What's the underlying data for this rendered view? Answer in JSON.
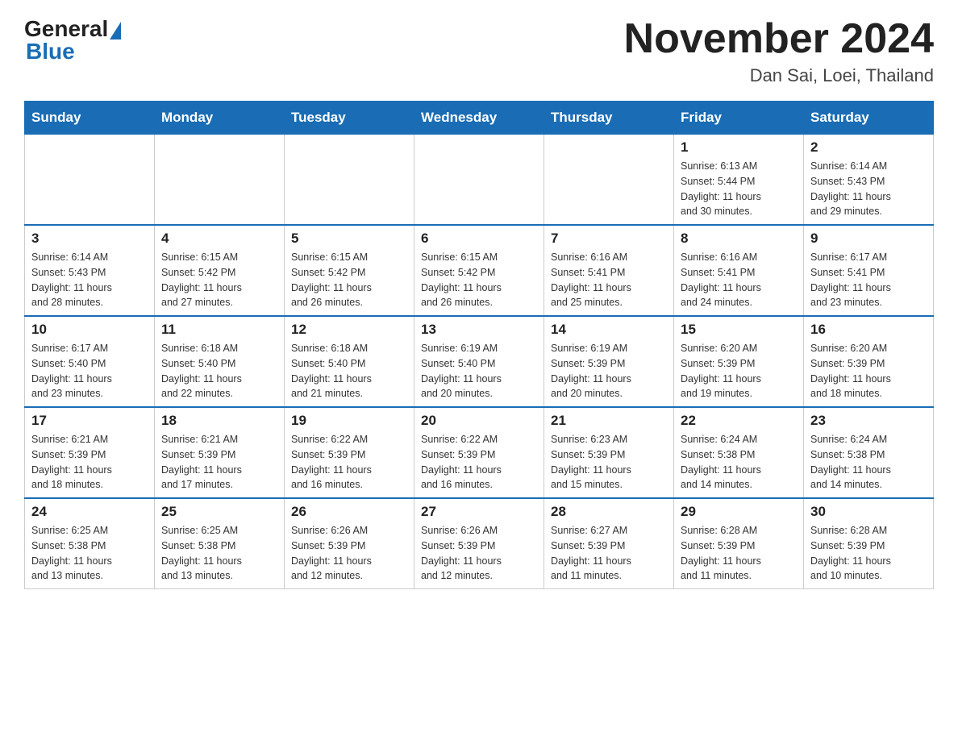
{
  "header": {
    "logo_text": "General",
    "logo_blue": "Blue",
    "title": "November 2024",
    "subtitle": "Dan Sai, Loei, Thailand"
  },
  "weekdays": [
    "Sunday",
    "Monday",
    "Tuesday",
    "Wednesday",
    "Thursday",
    "Friday",
    "Saturday"
  ],
  "weeks": [
    [
      {
        "day": "",
        "info": ""
      },
      {
        "day": "",
        "info": ""
      },
      {
        "day": "",
        "info": ""
      },
      {
        "day": "",
        "info": ""
      },
      {
        "day": "",
        "info": ""
      },
      {
        "day": "1",
        "info": "Sunrise: 6:13 AM\nSunset: 5:44 PM\nDaylight: 11 hours\nand 30 minutes."
      },
      {
        "day": "2",
        "info": "Sunrise: 6:14 AM\nSunset: 5:43 PM\nDaylight: 11 hours\nand 29 minutes."
      }
    ],
    [
      {
        "day": "3",
        "info": "Sunrise: 6:14 AM\nSunset: 5:43 PM\nDaylight: 11 hours\nand 28 minutes."
      },
      {
        "day": "4",
        "info": "Sunrise: 6:15 AM\nSunset: 5:42 PM\nDaylight: 11 hours\nand 27 minutes."
      },
      {
        "day": "5",
        "info": "Sunrise: 6:15 AM\nSunset: 5:42 PM\nDaylight: 11 hours\nand 26 minutes."
      },
      {
        "day": "6",
        "info": "Sunrise: 6:15 AM\nSunset: 5:42 PM\nDaylight: 11 hours\nand 26 minutes."
      },
      {
        "day": "7",
        "info": "Sunrise: 6:16 AM\nSunset: 5:41 PM\nDaylight: 11 hours\nand 25 minutes."
      },
      {
        "day": "8",
        "info": "Sunrise: 6:16 AM\nSunset: 5:41 PM\nDaylight: 11 hours\nand 24 minutes."
      },
      {
        "day": "9",
        "info": "Sunrise: 6:17 AM\nSunset: 5:41 PM\nDaylight: 11 hours\nand 23 minutes."
      }
    ],
    [
      {
        "day": "10",
        "info": "Sunrise: 6:17 AM\nSunset: 5:40 PM\nDaylight: 11 hours\nand 23 minutes."
      },
      {
        "day": "11",
        "info": "Sunrise: 6:18 AM\nSunset: 5:40 PM\nDaylight: 11 hours\nand 22 minutes."
      },
      {
        "day": "12",
        "info": "Sunrise: 6:18 AM\nSunset: 5:40 PM\nDaylight: 11 hours\nand 21 minutes."
      },
      {
        "day": "13",
        "info": "Sunrise: 6:19 AM\nSunset: 5:40 PM\nDaylight: 11 hours\nand 20 minutes."
      },
      {
        "day": "14",
        "info": "Sunrise: 6:19 AM\nSunset: 5:39 PM\nDaylight: 11 hours\nand 20 minutes."
      },
      {
        "day": "15",
        "info": "Sunrise: 6:20 AM\nSunset: 5:39 PM\nDaylight: 11 hours\nand 19 minutes."
      },
      {
        "day": "16",
        "info": "Sunrise: 6:20 AM\nSunset: 5:39 PM\nDaylight: 11 hours\nand 18 minutes."
      }
    ],
    [
      {
        "day": "17",
        "info": "Sunrise: 6:21 AM\nSunset: 5:39 PM\nDaylight: 11 hours\nand 18 minutes."
      },
      {
        "day": "18",
        "info": "Sunrise: 6:21 AM\nSunset: 5:39 PM\nDaylight: 11 hours\nand 17 minutes."
      },
      {
        "day": "19",
        "info": "Sunrise: 6:22 AM\nSunset: 5:39 PM\nDaylight: 11 hours\nand 16 minutes."
      },
      {
        "day": "20",
        "info": "Sunrise: 6:22 AM\nSunset: 5:39 PM\nDaylight: 11 hours\nand 16 minutes."
      },
      {
        "day": "21",
        "info": "Sunrise: 6:23 AM\nSunset: 5:39 PM\nDaylight: 11 hours\nand 15 minutes."
      },
      {
        "day": "22",
        "info": "Sunrise: 6:24 AM\nSunset: 5:38 PM\nDaylight: 11 hours\nand 14 minutes."
      },
      {
        "day": "23",
        "info": "Sunrise: 6:24 AM\nSunset: 5:38 PM\nDaylight: 11 hours\nand 14 minutes."
      }
    ],
    [
      {
        "day": "24",
        "info": "Sunrise: 6:25 AM\nSunset: 5:38 PM\nDaylight: 11 hours\nand 13 minutes."
      },
      {
        "day": "25",
        "info": "Sunrise: 6:25 AM\nSunset: 5:38 PM\nDaylight: 11 hours\nand 13 minutes."
      },
      {
        "day": "26",
        "info": "Sunrise: 6:26 AM\nSunset: 5:39 PM\nDaylight: 11 hours\nand 12 minutes."
      },
      {
        "day": "27",
        "info": "Sunrise: 6:26 AM\nSunset: 5:39 PM\nDaylight: 11 hours\nand 12 minutes."
      },
      {
        "day": "28",
        "info": "Sunrise: 6:27 AM\nSunset: 5:39 PM\nDaylight: 11 hours\nand 11 minutes."
      },
      {
        "day": "29",
        "info": "Sunrise: 6:28 AM\nSunset: 5:39 PM\nDaylight: 11 hours\nand 11 minutes."
      },
      {
        "day": "30",
        "info": "Sunrise: 6:28 AM\nSunset: 5:39 PM\nDaylight: 11 hours\nand 10 minutes."
      }
    ]
  ]
}
